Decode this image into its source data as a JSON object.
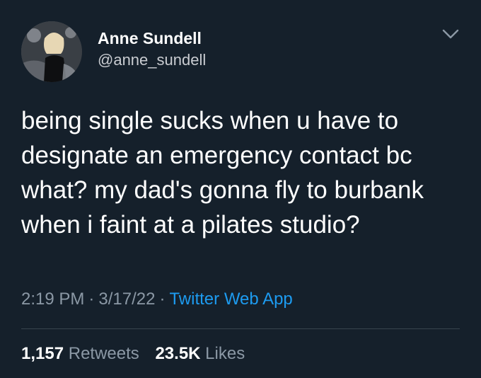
{
  "author": {
    "display_name": "Anne Sundell",
    "handle": "@anne_sundell",
    "avatar_icon": "profile-photo"
  },
  "tweet": {
    "text_lines": [
      "being single sucks when u have to",
      "designate an emergency contact bc",
      "what? my dad's gonna fly to burbank",
      "when i faint at a pilates studio?"
    ]
  },
  "meta": {
    "time": "2:19 PM",
    "separator": "·",
    "date": "3/17/22",
    "source": "Twitter Web App"
  },
  "stats": {
    "retweets_count": "1,157",
    "retweets_label": "Retweets",
    "likes_count": "23.5K",
    "likes_label": "Likes"
  },
  "colors": {
    "background": "#15202b",
    "primary_text": "#ffffff",
    "secondary_text": "#8b98a5",
    "link": "#1d9bf0",
    "divider": "#38444d"
  },
  "icons": {
    "menu": "chevron-down-icon"
  }
}
